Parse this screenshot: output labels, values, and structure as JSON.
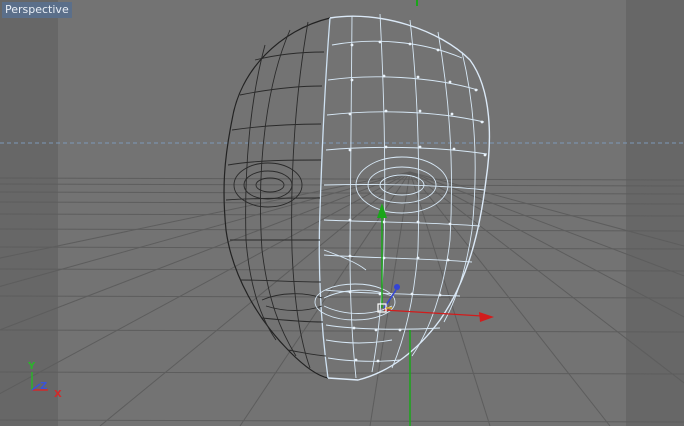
{
  "viewport": {
    "view_name": "Perspective",
    "background_color": "#737373",
    "grid_color": "#5e5e5e",
    "horizon_guide_color": "#6f8fb0"
  },
  "object": {
    "type": "head-mesh",
    "selected_half_color": "#d7e8f6",
    "unselected_half_color": "#262626"
  },
  "gizmo": {
    "x_axis_color": "#d21c1c",
    "y_axis_color": "#1aa61a",
    "z_axis_color": "#3344d6"
  },
  "orientation_indicator": {
    "y_label": "Y",
    "z_label": "Z",
    "x_label": "X",
    "x_color": "#d22a2a",
    "y_color": "#2bb32b",
    "z_color": "#3a54d8"
  },
  "icons": [
    "move-gizmo-icon",
    "axis-indicator-icon"
  ]
}
